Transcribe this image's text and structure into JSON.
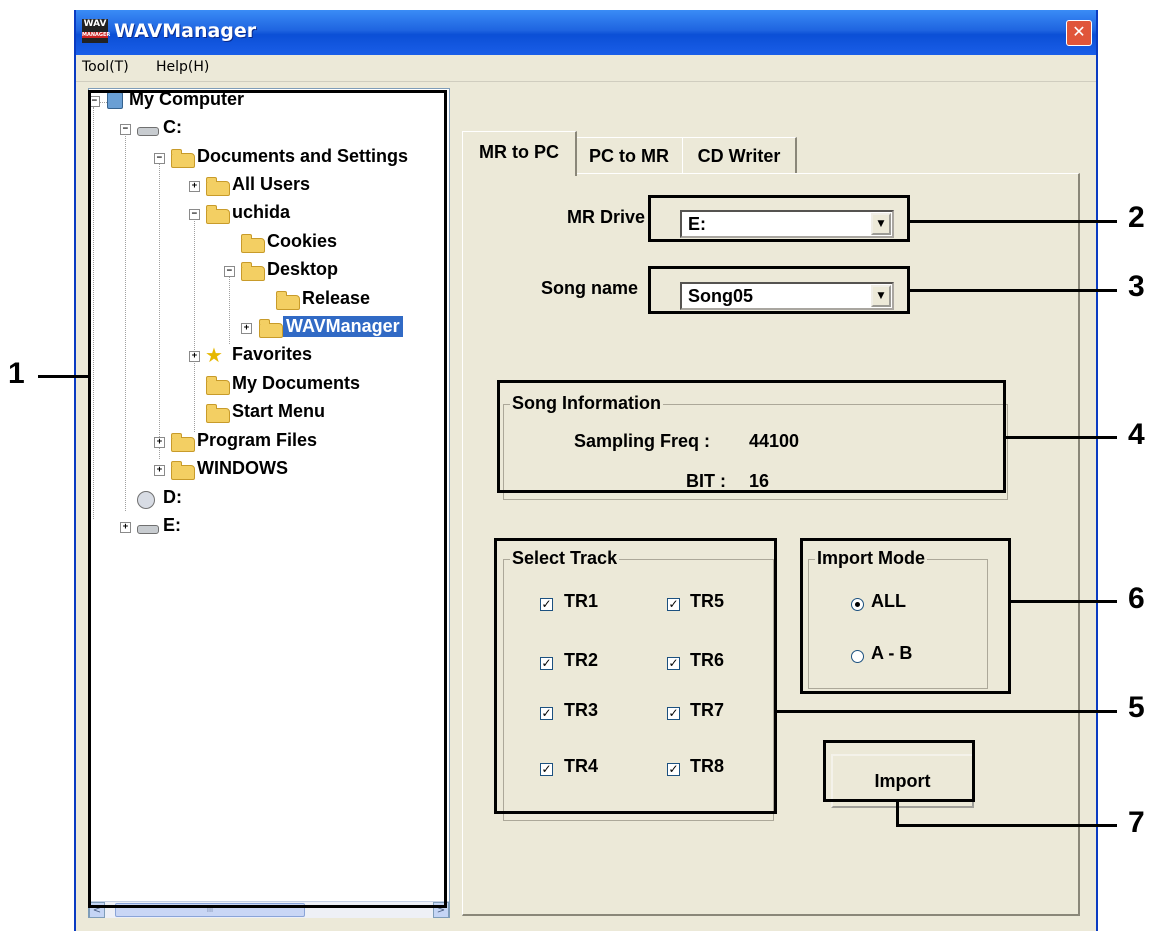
{
  "window": {
    "title": "WAVManager",
    "close_glyph": "✕",
    "icon_text": "WAV",
    "icon_subtext": "MANAGER"
  },
  "menu": {
    "items": [
      "Tool(T)",
      "Help(H)"
    ]
  },
  "tree": {
    "items": [
      {
        "label": "My Computer",
        "icon": "computer-icon"
      },
      {
        "label": "C:",
        "icon": "drive-icon"
      },
      {
        "label": "Documents and Settings",
        "icon": "folder-icon"
      },
      {
        "label": "All Users",
        "icon": "folder-icon"
      },
      {
        "label": "uchida",
        "icon": "folder-icon"
      },
      {
        "label": "Cookies",
        "icon": "folder-icon"
      },
      {
        "label": "Desktop",
        "icon": "folder-icon"
      },
      {
        "label": "Release",
        "icon": "folder-icon"
      },
      {
        "label": "WAVManager",
        "icon": "folder-icon",
        "selected": true
      },
      {
        "label": "Favorites",
        "icon": "star-icon"
      },
      {
        "label": "My Documents",
        "icon": "folder-icon"
      },
      {
        "label": "Start Menu",
        "icon": "folder-icon"
      },
      {
        "label": "Program Files",
        "icon": "folder-icon"
      },
      {
        "label": "WINDOWS",
        "icon": "folder-icon"
      },
      {
        "label": "D:",
        "icon": "cd-drive-icon"
      },
      {
        "label": "E:",
        "icon": "drive-icon"
      }
    ],
    "scroll_left": "<",
    "scroll_right": ">",
    "thumb_grip": "III"
  },
  "tabs": [
    {
      "label": "MR to PC",
      "active": true
    },
    {
      "label": "PC to MR",
      "active": false
    },
    {
      "label": "CD Writer",
      "active": false
    }
  ],
  "mr_drive": {
    "label": "MR Drive",
    "value": "E:"
  },
  "song_name": {
    "label": "Song name",
    "value": "Song05"
  },
  "combo_arrow": "▼",
  "song_info": {
    "title": "Song Information",
    "freq_label": "Sampling Freq :",
    "freq_value": "44100",
    "bit_label": "BIT :",
    "bit_value": "16"
  },
  "select_track": {
    "title": "Select Track",
    "tracks": [
      "TR1",
      "TR2",
      "TR3",
      "TR4",
      "TR5",
      "TR6",
      "TR7",
      "TR8"
    ],
    "checkmark": "✓"
  },
  "import_mode": {
    "title": "Import Mode",
    "options": [
      "ALL",
      "A - B"
    ],
    "selected": "ALL"
  },
  "import_button": "Import",
  "callouts": [
    "1",
    "2",
    "3",
    "4",
    "5",
    "6",
    "7"
  ],
  "colors": {
    "titlebar": "#1f64e0",
    "window_bg": "#ece9d8",
    "selection": "#316ac5",
    "close": "#e0553a"
  }
}
